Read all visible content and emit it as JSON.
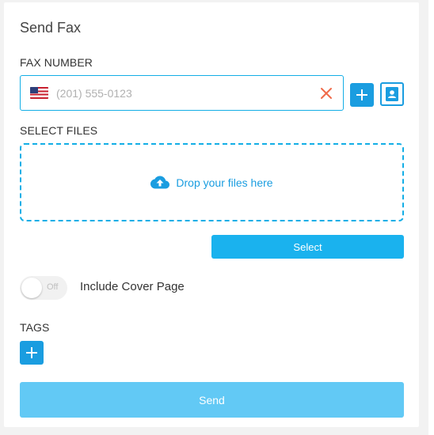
{
  "page": {
    "title": "Send Fax"
  },
  "fax_number": {
    "label": "FAX NUMBER",
    "country_icon": "us-flag-icon",
    "value": "",
    "placeholder": "(201) 555-0123",
    "clear_icon": "close-icon",
    "add_button_icon": "plus-icon",
    "contacts_button_icon": "contacts-book-icon"
  },
  "select_files": {
    "label": "SELECT FILES",
    "dropzone_icon": "cloud-upload-icon",
    "dropzone_text": "Drop your files here",
    "select_label": "Select"
  },
  "cover_page": {
    "toggle_state": "Off",
    "label": "Include Cover Page",
    "enabled": false
  },
  "tags": {
    "label": "TAGS",
    "add_icon": "plus-icon"
  },
  "actions": {
    "send_label": "Send"
  },
  "colors": {
    "accent": "#1a9de0",
    "input_border": "#13aee6",
    "select_button": "#1ab2ee",
    "send_button_disabled": "#62c9f5",
    "clear_icon": "#f06a4a"
  }
}
